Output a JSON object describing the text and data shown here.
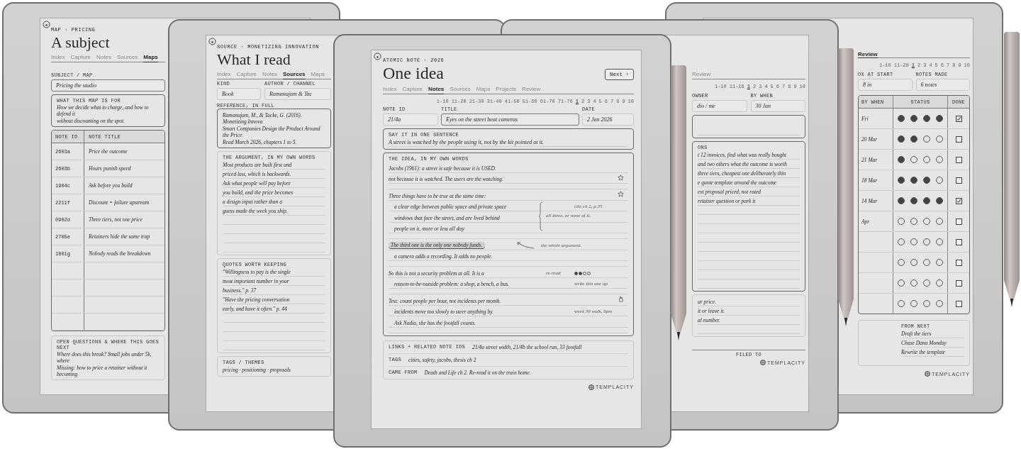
{
  "devices": [
    {
      "kind": "map",
      "eyebrow": "MAP · PRICING",
      "title": "A subject",
      "tabs": [
        {
          "label": "Index",
          "selected": false
        },
        {
          "label": "Capture",
          "selected": false
        },
        {
          "label": "Notes",
          "selected": false
        },
        {
          "label": "Sources",
          "selected": false
        },
        {
          "label": "Maps",
          "selected": true
        }
      ],
      "subject_label": "SUBJECT / MAP",
      "subject": "Pricing the studio",
      "purpose": {
        "label": "WHAT THIS MAP IS FOR",
        "lines": [
          "How we decide what to charge, and how to defend it",
          "without discounting on the spot."
        ]
      },
      "table": {
        "columns": [
          "NOTE ID",
          "NOTE TITLE"
        ],
        "rows": [
          {
            "id": "2603a",
            "title": "Price the outcome"
          },
          {
            "id": "2603b",
            "title": "Hours punish speed"
          },
          {
            "id": "1904c",
            "title": "Ask before you build"
          },
          {
            "id": "2211f",
            "title": "Discount = failure upstream"
          },
          {
            "id": "0902d",
            "title": "Three tiers, not one price"
          },
          {
            "id": "2705e",
            "title": "Retainers hide the same trap"
          },
          {
            "id": "1801g",
            "title": "Nobody reads the breakdown"
          }
        ]
      },
      "next": {
        "label": "OPEN QUESTIONS & WHERE THIS GOES NEXT",
        "lines": [
          "Where does this break? Small jobs under 5k, where",
          "Missing: how to price a retainer without it becoming"
        ]
      }
    },
    {
      "kind": "source",
      "eyebrow": "SOURCE · MONETIZING INNOVATION",
      "title": "What I read",
      "tabs": [
        {
          "label": "Index",
          "selected": false
        },
        {
          "label": "Capture",
          "selected": false
        },
        {
          "label": "Notes",
          "selected": false
        },
        {
          "label": "Sources",
          "selected": true
        },
        {
          "label": "Maps",
          "selected": false
        }
      ],
      "fields": [
        {
          "label": "KIND",
          "value": "Book"
        },
        {
          "label": "AUTHOR / CHANNEL",
          "value": "Ramanujam & Tac"
        }
      ],
      "reference": {
        "label": "REFERENCE, IN FULL",
        "lines": [
          "Ramanujam, M., & Tacke, G. (2016). Monetizing Innova",
          "Smart Companies Design the Product Around the Price.",
          "Read March 2026, chapters 1 to 5."
        ]
      },
      "argument": {
        "label": "THE ARGUMENT, IN MY OWN WORDS",
        "lines": [
          "Most products are built first and",
          "priced last, which is backwards.",
          "Ask what people will pay before",
          "you build, and the price becomes",
          "a design input rather than a",
          "guess made the week you ship."
        ]
      },
      "quotes": {
        "label": "QUOTES WORTH KEEPING",
        "lines": [
          "\"Willingness to pay is the single",
          "most important number in your",
          "business.\" p. 37",
          "\"Have the pricing conversation",
          "early, and have it often.\" p. 44"
        ]
      },
      "tags": {
        "label": "TAGS / THEMES",
        "value": "pricing · positioning · proposals"
      }
    },
    {
      "kind": "note",
      "eyebrow": "ATOMIC NOTE · 2026",
      "title": "One idea",
      "next_button": "Next ›",
      "tabs": [
        {
          "label": "Index",
          "selected": false
        },
        {
          "label": "Capture",
          "selected": false
        },
        {
          "label": "Notes",
          "selected": true
        },
        {
          "label": "Sources",
          "selected": false
        },
        {
          "label": "Maps",
          "selected": false
        },
        {
          "label": "Projects",
          "selected": false
        },
        {
          "label": "Review",
          "selected": false
        }
      ],
      "pager": [
        {
          "label": "1-10",
          "selected": false
        },
        {
          "label": "11-20",
          "selected": false
        },
        {
          "label": "21-30",
          "selected": false
        },
        {
          "label": "31-40",
          "selected": false
        },
        {
          "label": "41-50",
          "selected": false
        },
        {
          "label": "51-60",
          "selected": false
        },
        {
          "label": "61-70",
          "selected": false
        },
        {
          "label": "71-76",
          "selected": false
        },
        {
          "label": "1",
          "selected": true
        },
        {
          "label": "2",
          "selected": false
        },
        {
          "label": "3",
          "selected": false
        },
        {
          "label": "4",
          "selected": false
        },
        {
          "label": "5",
          "selected": false
        },
        {
          "label": "6",
          "selected": false
        },
        {
          "label": "7",
          "selected": false
        },
        {
          "label": "8",
          "selected": false
        },
        {
          "label": "9",
          "selected": false
        },
        {
          "label": "10",
          "selected": false
        }
      ],
      "fields": [
        {
          "label": "NOTE ID",
          "value": "21/4a"
        },
        {
          "label": "TITLE",
          "value": "Eyes on the street beat cameras"
        },
        {
          "label": "DATE",
          "value": "2 Jan 2026"
        }
      ],
      "sentence": {
        "label": "SAY IT IN ONE SENTENCE",
        "text": "A street is watched by the people using it, not by the kit pointed at it."
      },
      "idea": {
        "label": "THE IDEA, IN MY OWN WORDS",
        "lines": [
          {
            "kind": "plain",
            "text": "Jacobs (1961): a street is safe because it is USED."
          },
          {
            "kind": "starred",
            "text": "not because it is watched. The users are the watching."
          },
          {
            "kind": "starred",
            "text": "Three things have to be true at the same time:",
            "gap_before": true
          },
          {
            "kind": "sub",
            "text": "a clear edge between public space and private space",
            "note": "cite ch 2, p 35"
          },
          {
            "kind": "sub",
            "text": "windows that face the street, and are lived behind",
            "brace": true,
            "note": "all three, or none of it."
          },
          {
            "kind": "sub",
            "text": "people on it, more or less all day"
          },
          {
            "kind": "highlight",
            "text": "The third one is the only one nobody funds.",
            "arrow": true,
            "note": "the whole argument.",
            "gap_before": true
          },
          {
            "kind": "sub",
            "text": "a camera adds a recording. It adds no people."
          },
          {
            "kind": "plain",
            "text": "So this is not a security problem at all. It is a",
            "note": "re-read",
            "stars": 2,
            "gap_before": true
          },
          {
            "kind": "sub",
            "text": "reason-to-be-outside problem: a shop, a bench, a bus.",
            "note": "write this one up."
          },
          {
            "kind": "flagged",
            "text": "Test: count people per hour, not incidents per month.",
            "gap_before": true
          },
          {
            "kind": "sub",
            "text": "incidents move too slowly to steer anything by.",
            "note": "week 39 walk, 6pm"
          },
          {
            "kind": "sub",
            "text": "Ask Nadia, she has the footfall counts."
          }
        ]
      },
      "meta": [
        {
          "label": "LINKS + RELATED NOTE IDS",
          "value": "21/4a street width, 21/4b the school run, 33 footfall"
        },
        {
          "label": "TAGS",
          "value": "cities, safety, jacobs, thesis ch 2"
        },
        {
          "label": "CAME FROM",
          "value": "Death and Life ch 2. Re-read it on the train home."
        }
      ],
      "brand": "TEMPLACITY"
    },
    {
      "kind": "project",
      "tabs": [
        {
          "label": "Review",
          "selected": false
        }
      ],
      "pager": [
        {
          "label": "1-10",
          "selected": false
        },
        {
          "label": "11-16",
          "selected": false
        },
        {
          "label": "1",
          "selected": true
        },
        {
          "label": "2",
          "selected": false
        },
        {
          "label": "3",
          "selected": false
        },
        {
          "label": "4",
          "selected": false
        },
        {
          "label": "5",
          "selected": false
        },
        {
          "label": "6",
          "selected": false
        },
        {
          "label": "7",
          "selected": false
        },
        {
          "label": "8",
          "selected": false
        },
        {
          "label": "9",
          "selected": false
        },
        {
          "label": "10",
          "selected": false
        }
      ],
      "fields": [
        {
          "label": "OWNER",
          "value": "dio / me"
        },
        {
          "label": "BY WHEN",
          "value": "30 Jan"
        }
      ],
      "actions": {
        "label": "ONS",
        "lines": [
          "t 12 invoices, find what was really bought",
          "and two others what the outcome is worth",
          "three tiers, cheapest one deliberately thin",
          "e quote template around the outcome",
          "ext proposal priced, not rated",
          "retainer question or park it"
        ]
      },
      "outcome": [
        "ur price.",
        "it or leave it.",
        "al number."
      ],
      "filed": "FILED TO",
      "brand": "TEMPLACITY"
    },
    {
      "kind": "review",
      "tabs": [
        {
          "label": "Review",
          "selected": true
        }
      ],
      "pager": [
        {
          "label": "1-10",
          "selected": false
        },
        {
          "label": "11-20",
          "selected": false
        },
        {
          "label": "1",
          "selected": true
        },
        {
          "label": "2",
          "selected": false
        },
        {
          "label": "3",
          "selected": false
        },
        {
          "label": "4",
          "selected": false
        },
        {
          "label": "5",
          "selected": false
        },
        {
          "label": "6",
          "selected": false
        },
        {
          "label": "7",
          "selected": false
        },
        {
          "label": "8",
          "selected": false
        },
        {
          "label": "9",
          "selected": false
        },
        {
          "label": "10",
          "selected": false
        }
      ],
      "fields": [
        {
          "label": "OX AT START",
          "value": "8 in"
        },
        {
          "label": "NOTES MADE",
          "value": "6 notes"
        }
      ],
      "table": {
        "columns": [
          "BY WHEN",
          "STATUS",
          "DONE"
        ],
        "rows": [
          {
            "when": "Fri",
            "stars": 4,
            "checked": true
          },
          {
            "when": "20 Mar",
            "stars": 2,
            "checked": false
          },
          {
            "when": "21 Mar",
            "stars": 1,
            "checked": false
          },
          {
            "when": "18 Mar",
            "stars": 3,
            "checked": false
          },
          {
            "when": "14 Mar",
            "stars": 4,
            "checked": true
          },
          {
            "when": "Apr",
            "stars": 0,
            "checked": false
          },
          {
            "stars": 0,
            "checked": false
          },
          {
            "stars": 0,
            "checked": false
          },
          {
            "stars": 0,
            "checked": false
          },
          {
            "stars": 0,
            "checked": false
          }
        ]
      },
      "next": {
        "label": "FROM NEXT",
        "lines": [
          "Draft the tiers",
          "Chase Dana Monday",
          "Rewrite the template"
        ]
      },
      "brand": "TEMPLACITY"
    }
  ]
}
